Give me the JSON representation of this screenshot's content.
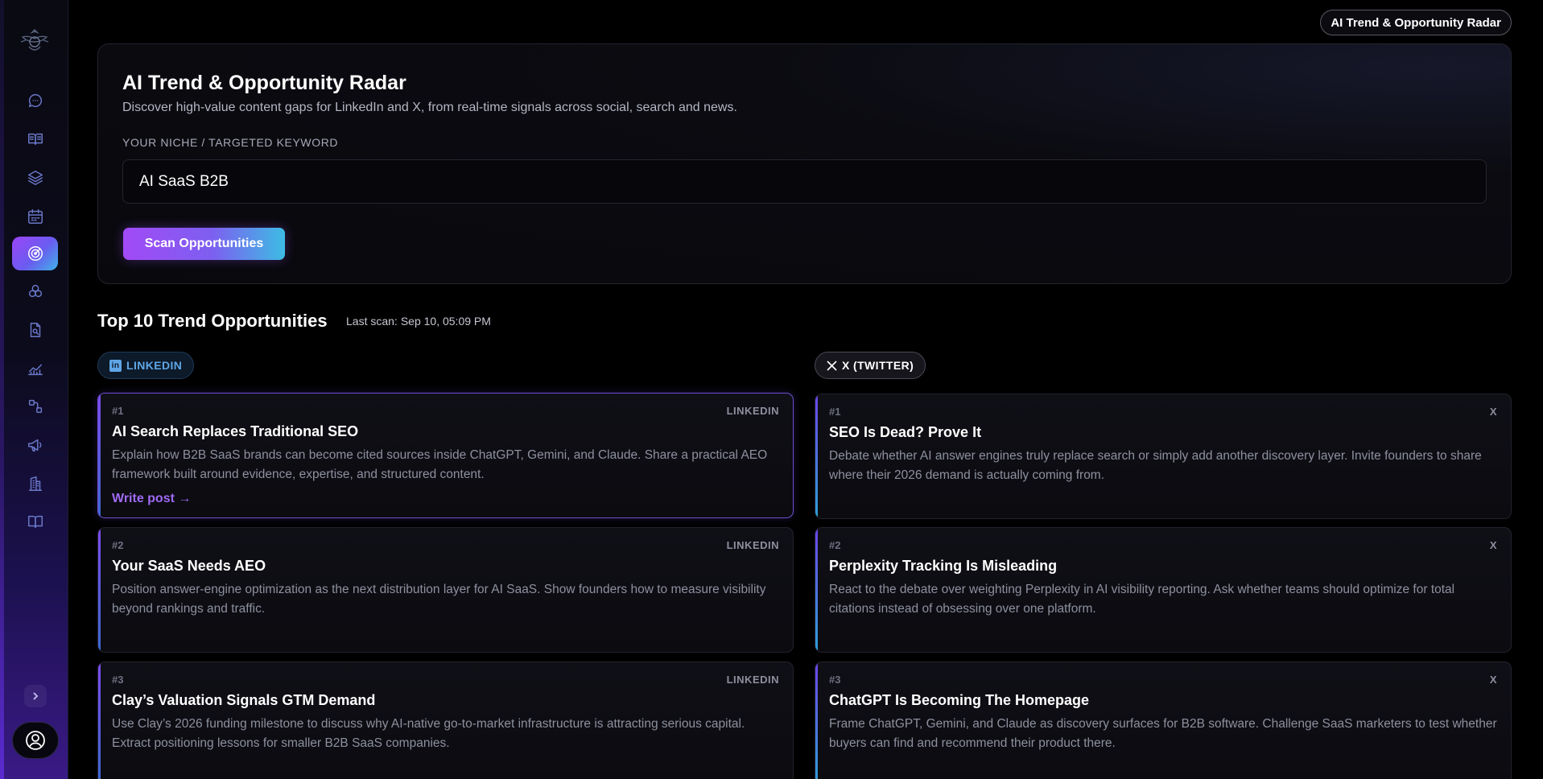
{
  "app": {
    "badge": "AI Trend & Opportunity Radar"
  },
  "sidebar": {
    "items": [
      {
        "icon": "chat-icon"
      },
      {
        "icon": "book-open-icon"
      },
      {
        "icon": "layers-icon"
      },
      {
        "icon": "calendar-icon"
      },
      {
        "icon": "radar-icon",
        "active": true
      },
      {
        "icon": "circles-icon"
      },
      {
        "icon": "file-search-icon"
      },
      {
        "icon": "chart-line-icon"
      },
      {
        "icon": "workflow-icon"
      },
      {
        "icon": "megaphone-icon"
      },
      {
        "icon": "building-icon"
      },
      {
        "icon": "book-icon"
      }
    ],
    "expand_icon": "chevron-right-icon",
    "user_icon": "user-circle-icon"
  },
  "hero": {
    "title": "AI Trend & Opportunity Radar",
    "subtitle": "Discover high-value content gaps for LinkedIn and X, from real-time signals across social, search and news.",
    "field_label": "YOUR NICHE / TARGETED KEYWORD",
    "keyword_value": "AI SaaS B2B",
    "scan_button": "Scan Opportunities"
  },
  "results": {
    "title": "Top 10 Trend Opportunities",
    "last_scan_label": "Last scan:",
    "last_scan_value": "Sep 10, 05:09 PM",
    "linkedin_pill": "LINKEDIN",
    "x_pill": "X (TWITTER)",
    "linkedin": [
      {
        "rank": "#1",
        "tag": "LINKEDIN",
        "title": "AI Search Replaces Traditional SEO",
        "desc": "Explain how B2B SaaS brands can become cited sources inside ChatGPT, Gemini, and Claude. Share a practical AEO framework built around evidence, expertise, and structured content.",
        "action": "Write post →"
      },
      {
        "rank": "#2",
        "tag": "LINKEDIN",
        "title": "Your SaaS Needs AEO",
        "desc": "Position answer-engine optimization as the next distribution layer for AI SaaS. Show founders how to measure visibility beyond rankings and traffic."
      },
      {
        "rank": "#3",
        "tag": "LINKEDIN",
        "title": "Clay’s Valuation Signals GTM Demand",
        "desc": "Use Clay’s 2026 funding milestone to discuss why AI-native go-to-market infrastructure is attracting serious capital. Extract positioning lessons for smaller B2B SaaS companies."
      }
    ],
    "x": [
      {
        "rank": "#1",
        "tag": "X",
        "title": "SEO Is Dead? Prove It",
        "desc": "Debate whether AI answer engines truly replace search or simply add another discovery layer. Invite founders to share where their 2026 demand is actually coming from."
      },
      {
        "rank": "#2",
        "tag": "X",
        "title": "Perplexity Tracking Is Misleading",
        "desc": "React to the debate over weighting Perplexity in AI visibility reporting. Ask whether teams should optimize for total citations instead of obsessing over one platform."
      },
      {
        "rank": "#3",
        "tag": "X",
        "title": "ChatGPT Is Becoming The Homepage",
        "desc": "Frame ChatGPT, Gemini, and Claude as discovery surfaces for B2B software. Challenge SaaS marketers to test whether buyers can find and recommend their product there."
      }
    ]
  }
}
